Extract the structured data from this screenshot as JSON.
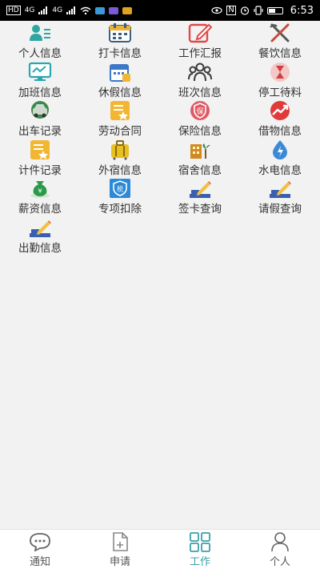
{
  "status_bar": {
    "time": "6:53",
    "network_left": "4G",
    "network_right": "4G",
    "battery_icon": "battery-icon"
  },
  "grid": {
    "items": [
      {
        "label": "个人信息",
        "icon": "person-info-icon",
        "color": "#2ea7a0"
      },
      {
        "label": "打卡信息",
        "icon": "calendar-clock-icon",
        "color": "#3b6fa0"
      },
      {
        "label": "工作汇报",
        "icon": "edit-report-icon",
        "color": "#e04a4a"
      },
      {
        "label": "餐饮信息",
        "icon": "fork-knife-icon",
        "color": "#c84a3a"
      },
      {
        "label": "加班信息",
        "icon": "monitor-icon",
        "color": "#2aa7b0"
      },
      {
        "label": "休假信息",
        "icon": "calendar-vacation-icon",
        "color": "#3b78c8"
      },
      {
        "label": "班次信息",
        "icon": "group-icon",
        "color": "#3a3a3a"
      },
      {
        "label": "停工待料",
        "icon": "hourglass-icon",
        "color": "#d04040"
      },
      {
        "label": "出车记录",
        "icon": "car-icon",
        "color": "#3a8a4a"
      },
      {
        "label": "劳动合同",
        "icon": "contract-icon",
        "color": "#f2b632"
      },
      {
        "label": "保险信息",
        "icon": "insurance-icon",
        "color": "#e05a64"
      },
      {
        "label": "借物信息",
        "icon": "trend-icon",
        "color": "#e03a3a"
      },
      {
        "label": "计件记录",
        "icon": "piecework-icon",
        "color": "#f2b632"
      },
      {
        "label": "外宿信息",
        "icon": "suitcase-icon",
        "color": "#e8c020"
      },
      {
        "label": "宿舍信息",
        "icon": "dorm-icon",
        "color": "#d08a20"
      },
      {
        "label": "水电信息",
        "icon": "water-electric-icon",
        "color": "#3a8ad8"
      },
      {
        "label": "薪资信息",
        "icon": "money-bag-icon",
        "color": "#2a9a4a"
      },
      {
        "label": "专项扣除",
        "icon": "deduction-shield-icon",
        "color": "#2a8ad8"
      },
      {
        "label": "签卡查询",
        "icon": "pencil-steps-icon",
        "color": "#3b5fb0"
      },
      {
        "label": "请假查询",
        "icon": "pencil-steps-icon",
        "color": "#3b5fb0"
      },
      {
        "label": "出勤信息",
        "icon": "pencil-steps-icon",
        "color": "#3b5fb0"
      }
    ]
  },
  "deduction_badge": "税",
  "insurance_badge": "保",
  "tabs": [
    {
      "label": "通知",
      "icon": "chat-bubble-icon"
    },
    {
      "label": "申请",
      "icon": "document-add-icon"
    },
    {
      "label": "工作",
      "icon": "grid-apps-icon"
    },
    {
      "label": "个人",
      "icon": "person-icon"
    }
  ],
  "active_tab": "工作",
  "colors": {
    "accent": "#3aa0a6",
    "background": "#f2f2f2",
    "tab_inactive": "#555555"
  }
}
